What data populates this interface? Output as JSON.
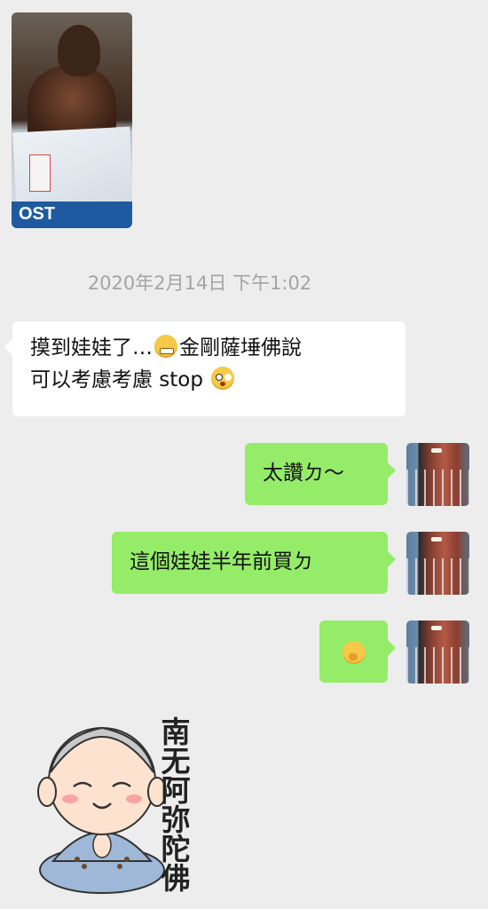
{
  "timestamp": "2020年2月14日 下午1:02",
  "photo": {
    "bag_text": "OST"
  },
  "messages": [
    {
      "side": "left",
      "line1_a": "摸到娃娃了…",
      "line1_b": "金剛薩埵佛說",
      "line2_a": "可以考慮考慮 stop"
    },
    {
      "side": "right",
      "text": "太讚ㄉ～"
    },
    {
      "side": "right",
      "text": "這個娃娃半年前買ㄉ"
    },
    {
      "side": "right",
      "text": ""
    }
  ],
  "sticker": {
    "text": "南\n无\n阿\n弥\n陀\n佛"
  },
  "icons": {
    "emoji1": "grimacing-face",
    "emoji2": "flushed-face",
    "emoji3": "face-with-hand-over-mouth"
  },
  "colors": {
    "background": "#ededed",
    "incoming_bubble": "#ffffff",
    "outgoing_bubble": "#95ec69",
    "timestamp": "#a4a4a4"
  }
}
